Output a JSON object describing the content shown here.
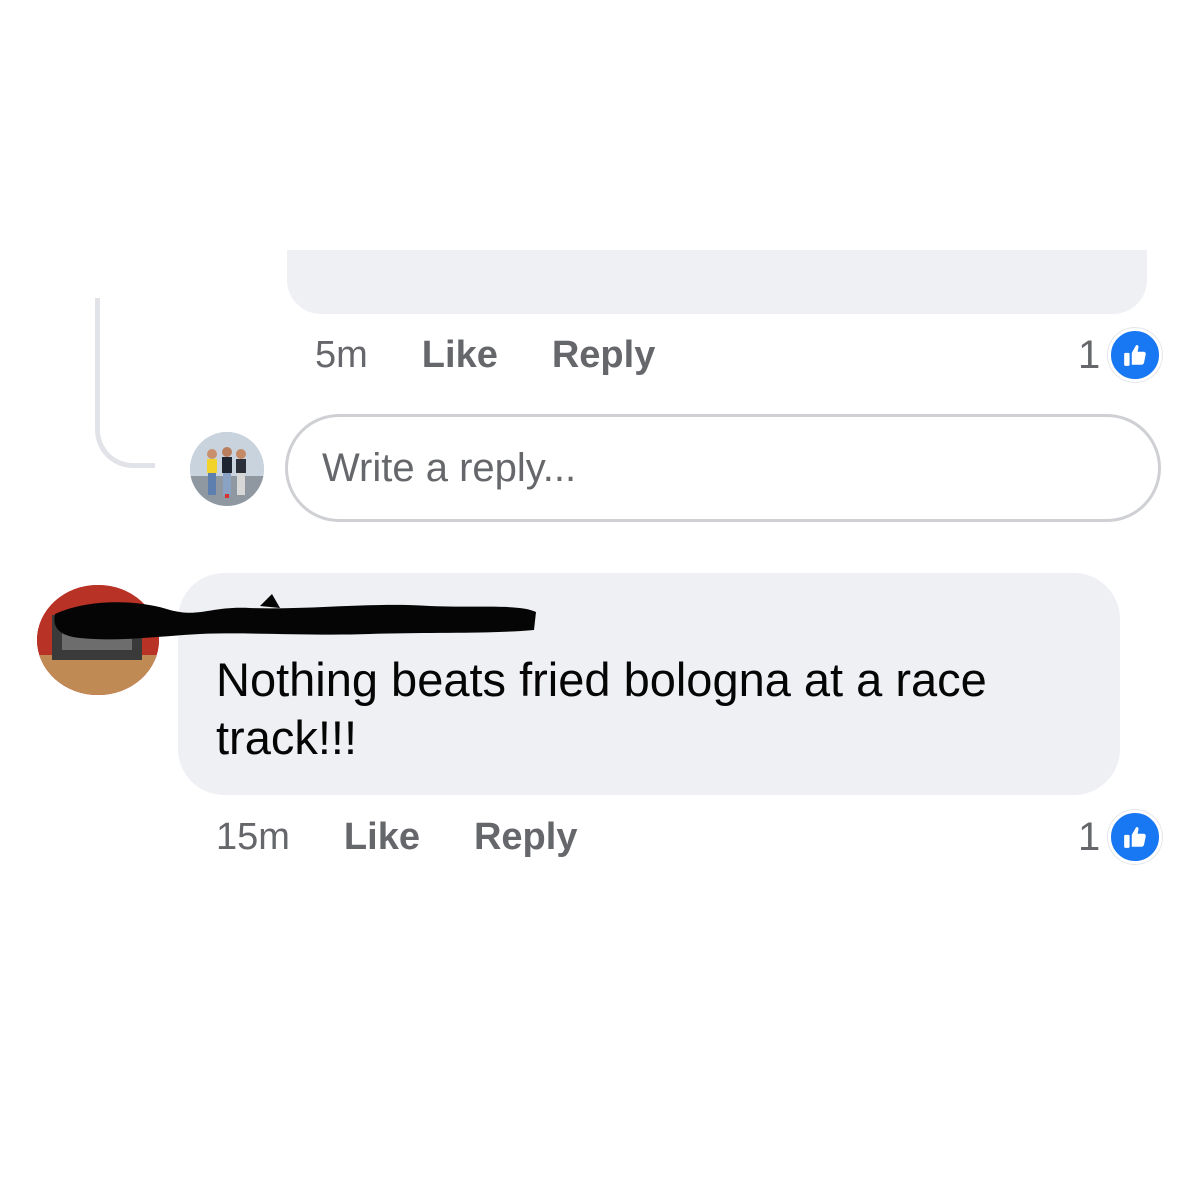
{
  "previous_comment": {
    "time": "5m",
    "like_label": "Like",
    "reply_label": "Reply",
    "reaction_count": "1"
  },
  "reply_box": {
    "placeholder": "Write a reply..."
  },
  "comment": {
    "text": "Nothing beats fried bologna at a race track!!!",
    "time": "15m",
    "like_label": "Like",
    "reply_label": "Reply",
    "reaction_count": "1"
  },
  "icons": {
    "reaction": "like-thumbs-up-icon"
  },
  "colors": {
    "like_blue": "#1877f2",
    "bubble_bg": "#eef0f4",
    "meta_text": "#65676b"
  }
}
